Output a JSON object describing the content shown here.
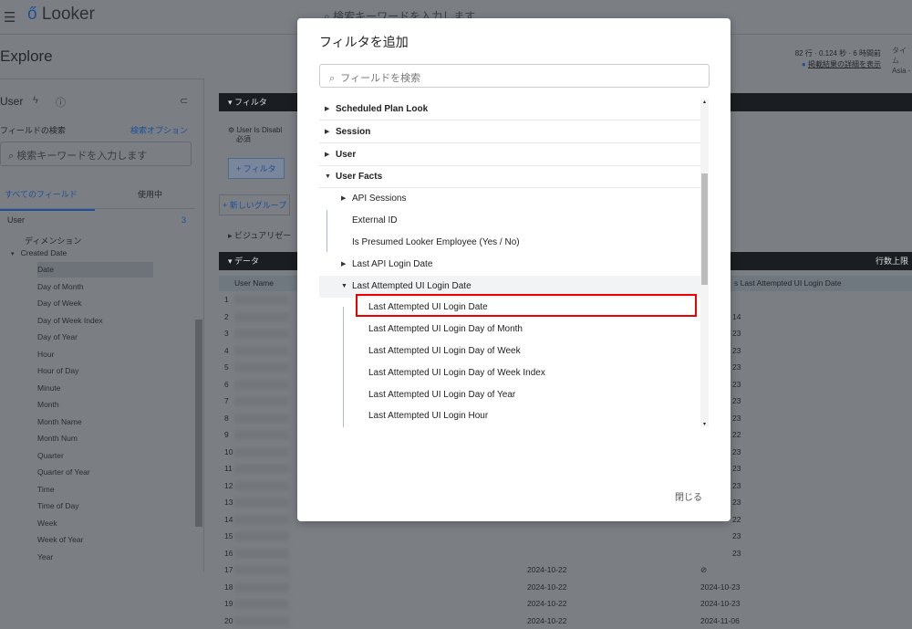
{
  "app": {
    "logo": "Looker",
    "search_placeholder": "検索キーワードを入力します",
    "page_title": "Explore"
  },
  "meta": {
    "stats": "82 行 · 0.124 秒 · 6 時間前",
    "details_link": "掲載結果の詳細を表示",
    "tz_label": "タイム",
    "tz_value": "Asia -"
  },
  "sidebar": {
    "title": "User",
    "field_search_label": "フィールドの検索",
    "search_options": "検索オプション",
    "search_placeholder": "検索キーワードを入力します",
    "tabs": [
      "すべてのフィールド",
      "使用中"
    ],
    "view": "User",
    "view_count": "3",
    "dimensions_label": "ディメンション",
    "group": "Created Date",
    "fields": [
      "Date",
      "Day of Month",
      "Day of Week",
      "Day of Week Index",
      "Day of Year",
      "Hour",
      "Hour of Day",
      "Minute",
      "Month",
      "Month Name",
      "Month Num",
      "Quarter",
      "Quarter of Year",
      "Time",
      "Time of Day",
      "Week",
      "Week of Year",
      "Year"
    ]
  },
  "main": {
    "filter_bar": "フィルタ",
    "filter_item": "User Is Disabl",
    "filter_required": "必須",
    "add_filter": "+ フィルタ",
    "new_group": "+ 新しいグループ",
    "visualization": "ビジュアリゼー",
    "data_bar": "データ",
    "row_limit": "行数上限",
    "col_user_name": "User Name",
    "col_last_login": "s Last Attempted UI Login Date",
    "rows": [
      {
        "n": "1",
        "a": "",
        "b": ""
      },
      {
        "n": "2",
        "a": "",
        "b": "14"
      },
      {
        "n": "3",
        "a": "",
        "b": "23"
      },
      {
        "n": "4",
        "a": "",
        "b": "23"
      },
      {
        "n": "5",
        "a": "",
        "b": "23"
      },
      {
        "n": "6",
        "a": "",
        "b": "23"
      },
      {
        "n": "7",
        "a": "",
        "b": "23"
      },
      {
        "n": "8",
        "a": "",
        "b": "23"
      },
      {
        "n": "9",
        "a": "",
        "b": "22"
      },
      {
        "n": "10",
        "a": "",
        "b": "23"
      },
      {
        "n": "11",
        "a": "",
        "b": "23"
      },
      {
        "n": "12",
        "a": "",
        "b": "23"
      },
      {
        "n": "13",
        "a": "",
        "b": "23"
      },
      {
        "n": "14",
        "a": "",
        "b": "22"
      },
      {
        "n": "15",
        "a": "",
        "b": "23"
      },
      {
        "n": "16",
        "a": "",
        "b": "23"
      },
      {
        "n": "17",
        "a": "2024-10-22",
        "b": "⊘"
      },
      {
        "n": "18",
        "a": "2024-10-22",
        "b": "2024-10-23"
      },
      {
        "n": "19",
        "a": "2024-10-22",
        "b": "2024-10-23"
      },
      {
        "n": "20",
        "a": "2024-10-22",
        "b": "2024-11-06"
      }
    ]
  },
  "dialog": {
    "title": "フィルタを追加",
    "search_placeholder": "フィールドを検索",
    "close": "閉じる",
    "tree": [
      {
        "label": "Scheduled Plan Look",
        "level": 0,
        "arrow": "right"
      },
      {
        "label": "Session",
        "level": 0,
        "arrow": "right"
      },
      {
        "label": "User",
        "level": 0,
        "arrow": "right"
      },
      {
        "label": "User Facts",
        "level": 0,
        "arrow": "down"
      },
      {
        "label": "API Sessions",
        "level": 1,
        "arrow": "right"
      },
      {
        "label": "External ID",
        "level": 1,
        "arrow": ""
      },
      {
        "label": "Is Presumed Looker Employee (Yes / No)",
        "level": 1,
        "arrow": ""
      },
      {
        "label": "Last API Login Date",
        "level": 1,
        "arrow": "right"
      },
      {
        "label": "Last Attempted UI Login Date",
        "level": 1,
        "arrow": "down"
      },
      {
        "label": "Last Attempted UI Login Date",
        "level": 2,
        "arrow": ""
      },
      {
        "label": "Last Attempted UI Login Day of Month",
        "level": 2,
        "arrow": ""
      },
      {
        "label": "Last Attempted UI Login Day of Week",
        "level": 2,
        "arrow": ""
      },
      {
        "label": "Last Attempted UI Login Day of Week Index",
        "level": 2,
        "arrow": ""
      },
      {
        "label": "Last Attempted UI Login Day of Year",
        "level": 2,
        "arrow": ""
      },
      {
        "label": "Last Attempted UI Login Hour",
        "level": 2,
        "arrow": ""
      }
    ]
  }
}
